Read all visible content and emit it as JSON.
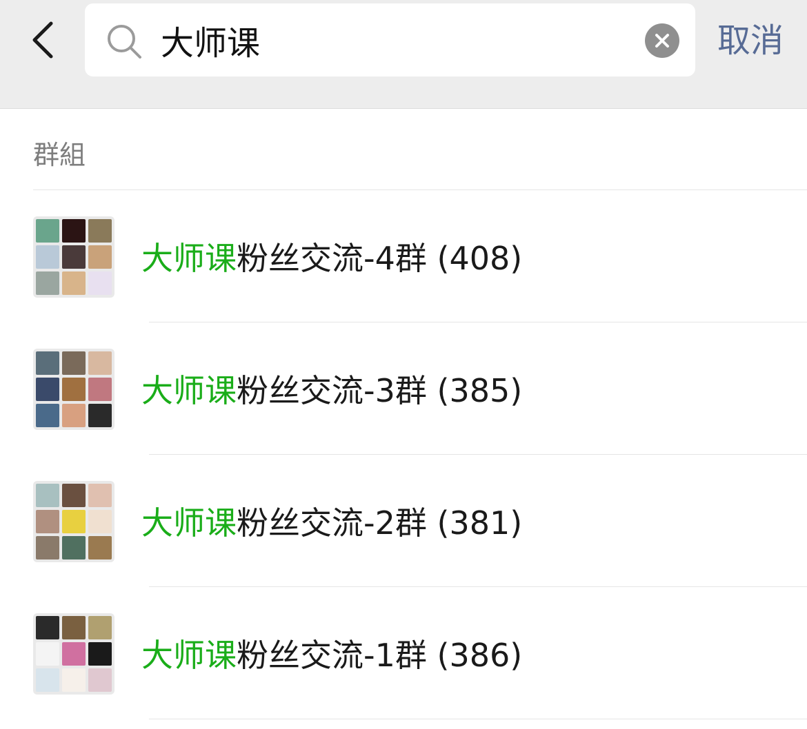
{
  "search": {
    "query": "大师课",
    "cancel_label": "取消"
  },
  "section": {
    "label": "群組"
  },
  "results": [
    {
      "highlight": "大师课",
      "rest": "粉丝交流-4群",
      "count": "(408)"
    },
    {
      "highlight": "大师课",
      "rest": "粉丝交流-3群",
      "count": "(385)"
    },
    {
      "highlight": "大师课",
      "rest": "粉丝交流-2群",
      "count": "(381)"
    },
    {
      "highlight": "大师课",
      "rest": "粉丝交流-1群",
      "count": "(386)"
    }
  ],
  "colors": {
    "highlight": "#1aad19",
    "cancel": "#576b95",
    "header_bg": "#ededed"
  },
  "icons": [
    "back-chevron-icon",
    "search-icon",
    "clear-icon"
  ]
}
